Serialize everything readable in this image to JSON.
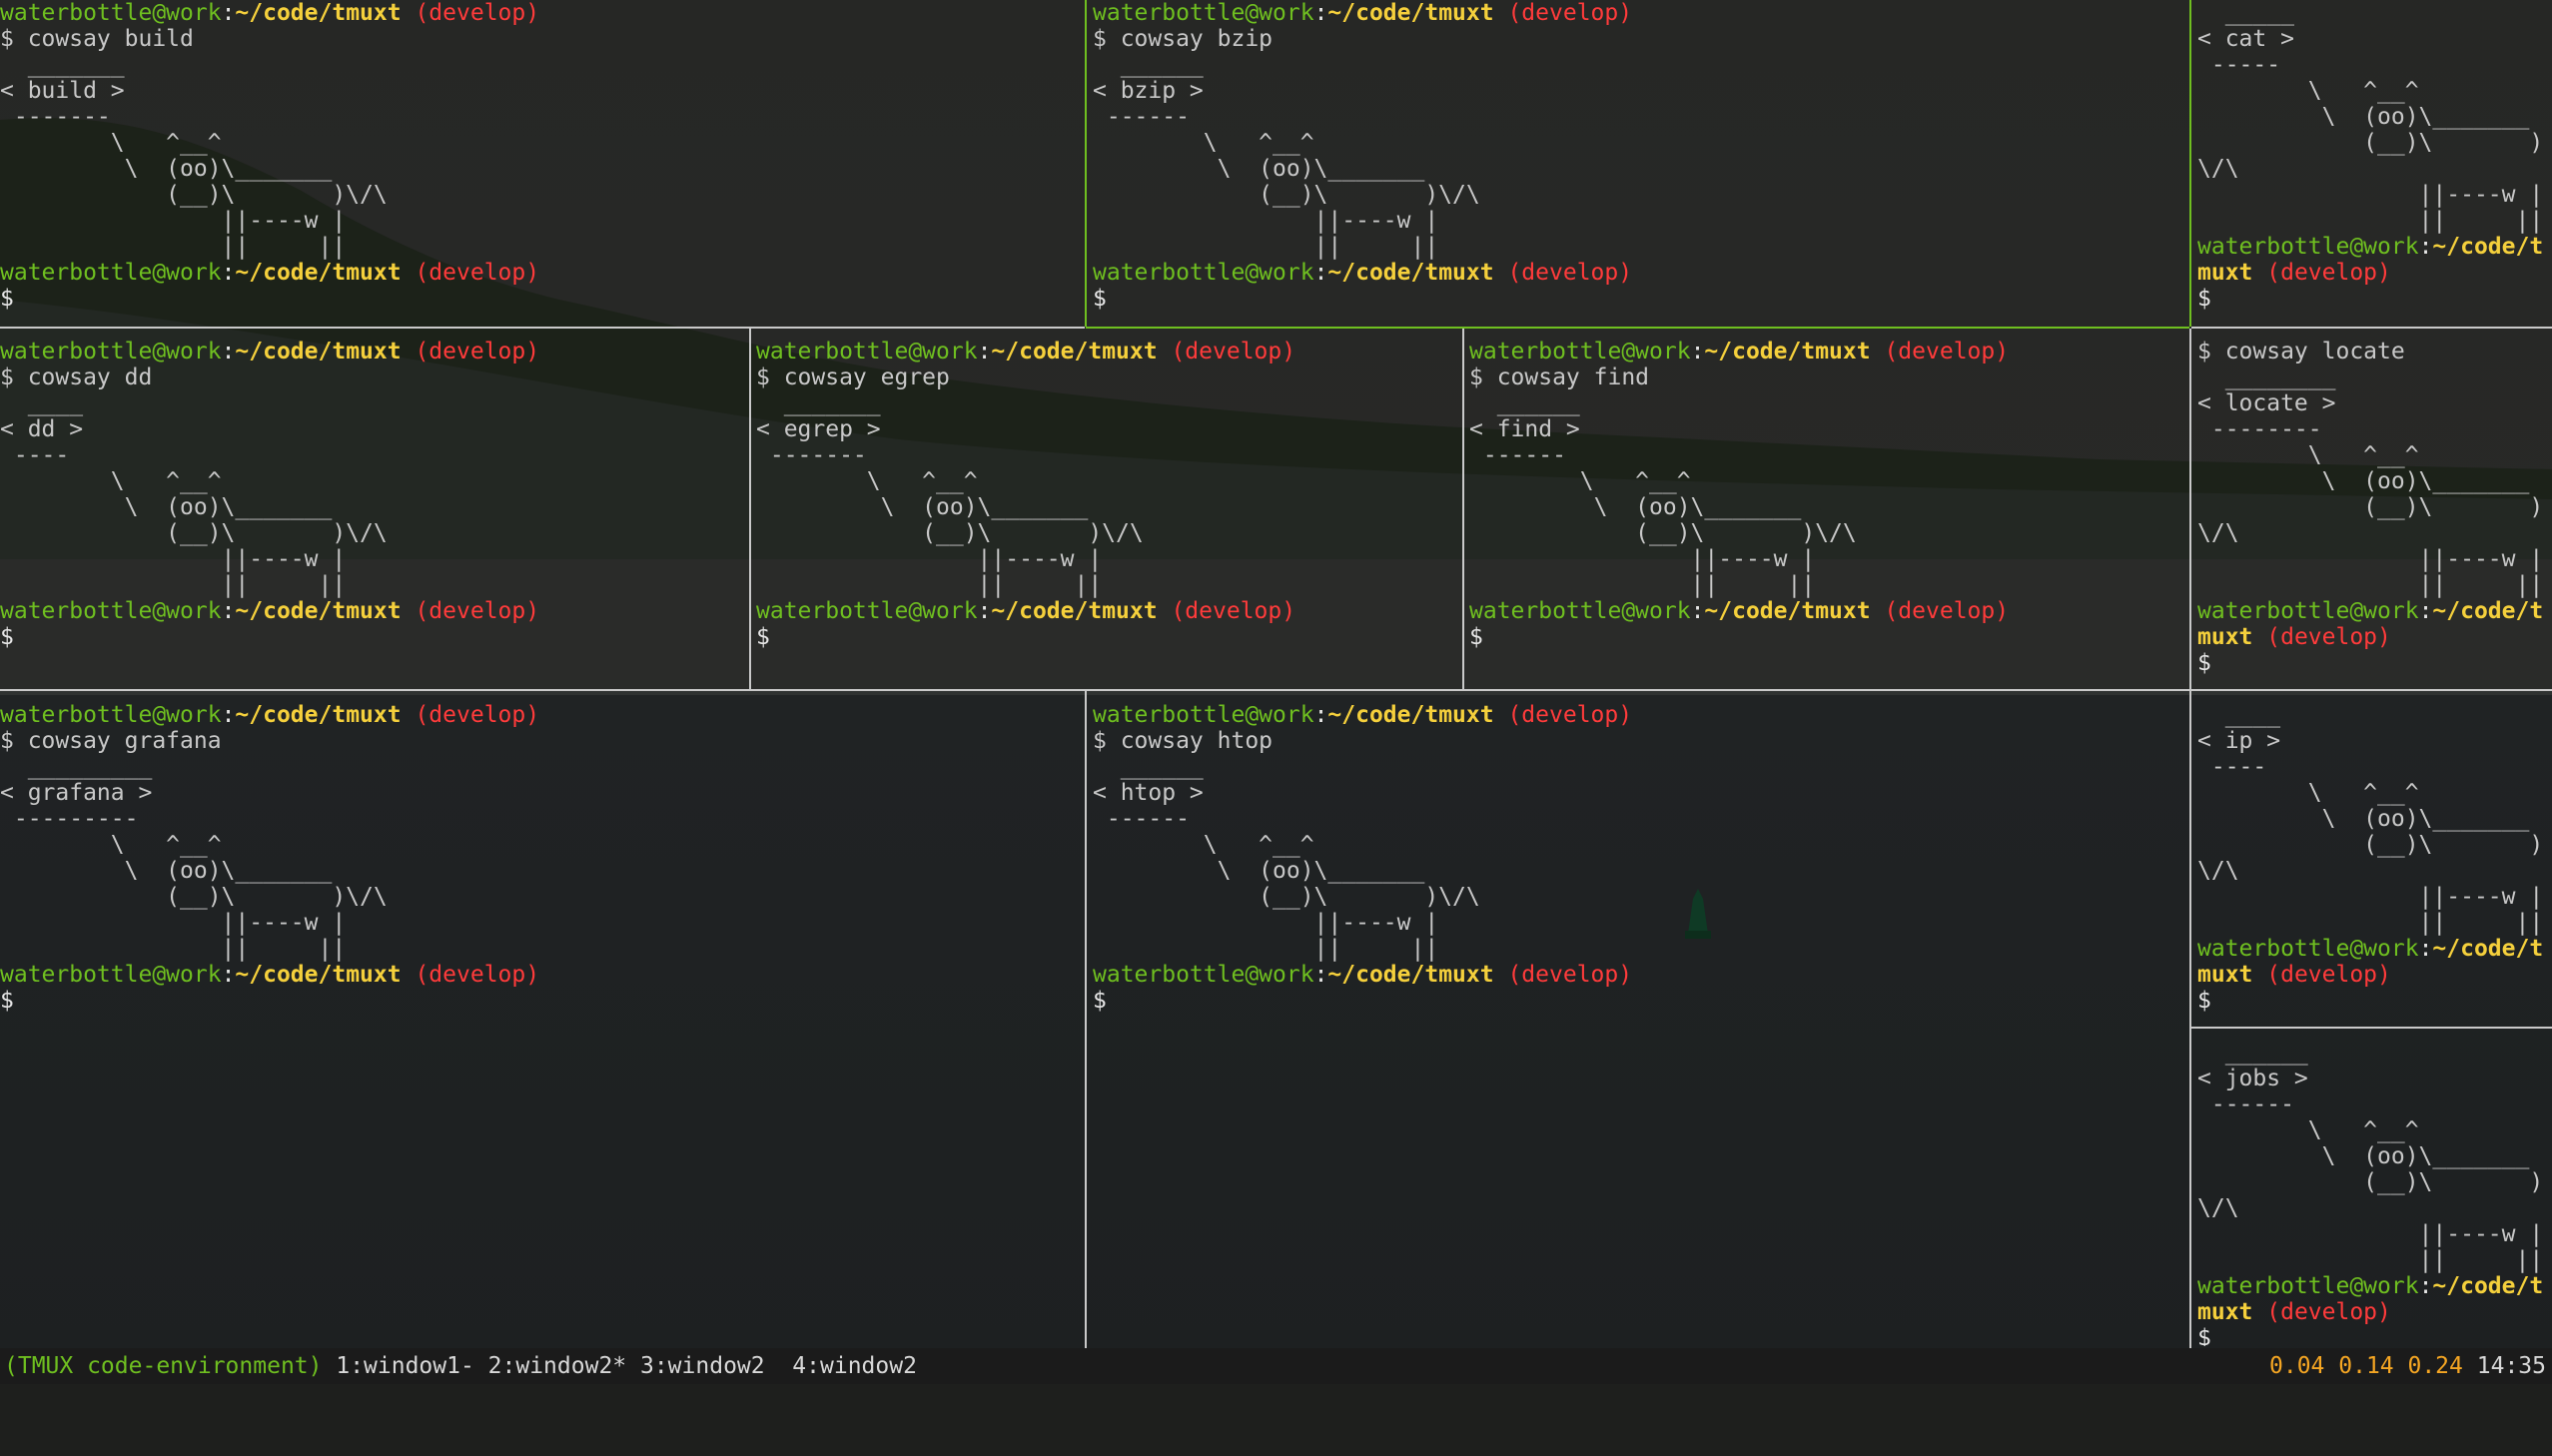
{
  "prompt": {
    "user_host": "waterbottle@work",
    "colon": ":",
    "path": "~/code/tmuxt",
    "path_wrap_a": "~/code/t",
    "path_wrap_b": "muxt",
    "branch": "(develop)",
    "dollar": "$"
  },
  "panes": [
    {
      "id": "build",
      "command": "$ cowsay build",
      "bubble": [
        "  _______",
        "< build >",
        " -------"
      ],
      "cow": [
        "        \\   ^__^",
        "         \\  (oo)\\_______",
        "            (__)\\       )\\/\\",
        "                ||----w |",
        "                ||     ||"
      ]
    },
    {
      "id": "bzip",
      "command": "$ cowsay bzip",
      "bubble": [
        "  ______",
        "< bzip >",
        " ------"
      ],
      "cow": [
        "        \\   ^__^",
        "         \\  (oo)\\_______",
        "            (__)\\       )\\/\\",
        "                ||----w |",
        "                ||     ||"
      ]
    },
    {
      "id": "cat",
      "command": "",
      "bubble": [
        "  _____",
        "< cat >",
        " -----"
      ],
      "cow": [
        "        \\   ^__^",
        "         \\  (oo)\\_______",
        "            (__)\\       )",
        "\\/\\",
        "                ||----w |",
        "                ||     ||"
      ]
    },
    {
      "id": "dd",
      "command": "$ cowsay dd",
      "bubble": [
        "  ____",
        "< dd >",
        " ----"
      ],
      "cow": [
        "        \\   ^__^",
        "         \\  (oo)\\_______",
        "            (__)\\       )\\/\\",
        "                ||----w |",
        "                ||     ||"
      ]
    },
    {
      "id": "egrep",
      "command": "$ cowsay egrep",
      "bubble": [
        "  _______",
        "< egrep >",
        " -------"
      ],
      "cow": [
        "        \\   ^__^",
        "         \\  (oo)\\_______",
        "            (__)\\       )\\/\\",
        "                ||----w |",
        "                ||     ||"
      ]
    },
    {
      "id": "find",
      "command": "$ cowsay find",
      "bubble": [
        "  ______",
        "< find >",
        " ------"
      ],
      "cow": [
        "        \\   ^__^",
        "         \\  (oo)\\_______",
        "            (__)\\       )\\/\\",
        "                ||----w |",
        "                ||     ||"
      ]
    },
    {
      "id": "locate",
      "command": "$ cowsay locate",
      "bubble": [
        "  ________",
        "< locate >",
        " --------"
      ],
      "cow": [
        "        \\   ^__^",
        "         \\  (oo)\\_______",
        "            (__)\\       )",
        "\\/\\",
        "                ||----w |",
        "                ||     ||"
      ]
    },
    {
      "id": "grafana",
      "command": "$ cowsay grafana",
      "bubble": [
        "  _________",
        "< grafana >",
        " ---------"
      ],
      "cow": [
        "        \\   ^__^",
        "         \\  (oo)\\_______",
        "            (__)\\       )\\/\\",
        "                ||----w |",
        "                ||     ||"
      ]
    },
    {
      "id": "htop",
      "command": "$ cowsay htop",
      "bubble": [
        "  ______",
        "< htop >",
        " ------"
      ],
      "cow": [
        "        \\   ^__^",
        "         \\  (oo)\\_______",
        "            (__)\\       )\\/\\",
        "                ||----w |",
        "                ||     ||"
      ]
    },
    {
      "id": "ip",
      "command": "",
      "bubble": [
        "  ____",
        "< ip >",
        " ----"
      ],
      "cow": [
        "        \\   ^__^",
        "         \\  (oo)\\_______",
        "            (__)\\       )",
        "\\/\\",
        "                ||----w |",
        "                ||     ||"
      ]
    },
    {
      "id": "jobs",
      "command": "",
      "bubble": [
        "  ______",
        "< jobs >",
        " ------"
      ],
      "cow": [
        "        \\   ^__^",
        "         \\  (oo)\\_______",
        "            (__)\\       )",
        "\\/\\",
        "                ||----w |",
        "                ||     ||"
      ]
    }
  ],
  "status_bar": {
    "session": "(TMUX code-environment)",
    "windows": " 1:window1- 2:window2* 3:window2  4:window2",
    "load": "0.04 0.14 0.24",
    "time": "14:35"
  },
  "colors": {
    "user_host": "#6fbf20",
    "path": "#f5d03c",
    "branch": "#ff3b3b",
    "active_border": "#6fbf20",
    "border": "#c9c9c9",
    "load": "#f5a623"
  }
}
